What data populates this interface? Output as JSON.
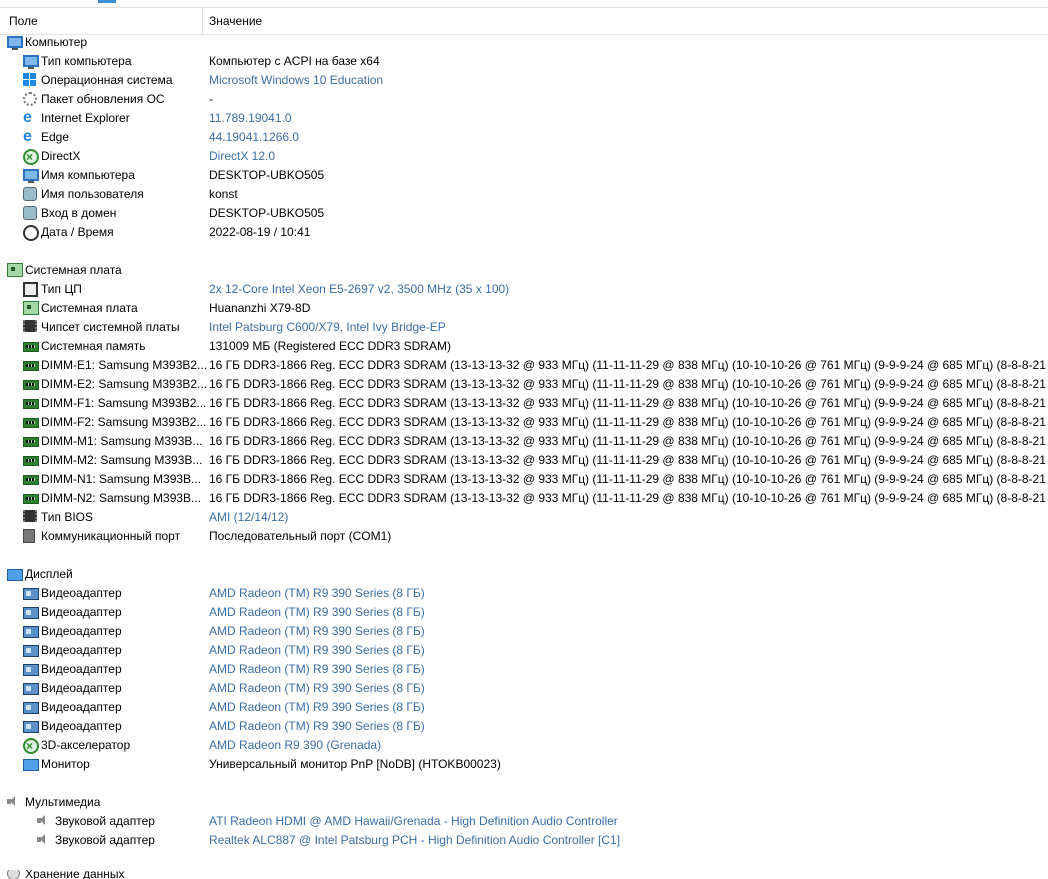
{
  "header": {
    "col_field": "Поле",
    "col_value": "Значение"
  },
  "computer": {
    "title": "Компьютер",
    "rows": [
      {
        "label": "Тип компьютера",
        "value": "Компьютер с ACPI на базе x64"
      },
      {
        "label": "Операционная система",
        "value": "Microsoft Windows 10 Education"
      },
      {
        "label": "Пакет обновления ОС",
        "value": "-"
      },
      {
        "label": "Internet Explorer",
        "value": "11.789.19041.0"
      },
      {
        "label": "Edge",
        "value": "44.19041.1266.0"
      },
      {
        "label": "DirectX",
        "value": "DirectX 12.0"
      },
      {
        "label": "Имя компьютера",
        "value": "DESKTOP-UBKO505"
      },
      {
        "label": "Имя пользователя",
        "value": "konst"
      },
      {
        "label": "Вход в домен",
        "value": "DESKTOP-UBKO505"
      },
      {
        "label": "Дата / Время",
        "value": "2022-08-19 / 10:41"
      }
    ]
  },
  "motherboard": {
    "title": "Системная плата",
    "rows": [
      {
        "label": "Тип ЦП",
        "value": "2x 12-Core Intel Xeon E5-2697 v2, 3500 MHz (35 x 100)"
      },
      {
        "label": "Системная плата",
        "value": "Huananzhi X79-8D"
      },
      {
        "label": "Чипсет системной платы",
        "value": "Intel Patsburg C600/X79, Intel Ivy Bridge-EP"
      },
      {
        "label": "Системная память",
        "value": "131009 МБ  (Registered ECC DDR3 SDRAM)"
      },
      {
        "label": "DIMM-E1: Samsung M393B2...",
        "value": "16 ГБ DDR3-1866 Reg. ECC DDR3 SDRAM  (13-13-13-32 @ 933 МГц)  (11-11-11-29 @ 838 МГц)  (10-10-10-26 @ 761 МГц)  (9-9-9-24 @ 685 МГц)  (8-8-8-21 ..."
      },
      {
        "label": "DIMM-E2: Samsung M393B2...",
        "value": "16 ГБ DDR3-1866 Reg. ECC DDR3 SDRAM  (13-13-13-32 @ 933 МГц)  (11-11-11-29 @ 838 МГц)  (10-10-10-26 @ 761 МГц)  (9-9-9-24 @ 685 МГц)  (8-8-8-21 ..."
      },
      {
        "label": "DIMM-F1: Samsung M393B2...",
        "value": "16 ГБ DDR3-1866 Reg. ECC DDR3 SDRAM  (13-13-13-32 @ 933 МГц)  (11-11-11-29 @ 838 МГц)  (10-10-10-26 @ 761 МГц)  (9-9-9-24 @ 685 МГц)  (8-8-8-21 ..."
      },
      {
        "label": "DIMM-F2: Samsung M393B2...",
        "value": "16 ГБ DDR3-1866 Reg. ECC DDR3 SDRAM  (13-13-13-32 @ 933 МГц)  (11-11-11-29 @ 838 МГц)  (10-10-10-26 @ 761 МГц)  (9-9-9-24 @ 685 МГц)  (8-8-8-21 ..."
      },
      {
        "label": "DIMM-M1: Samsung M393B...",
        "value": "16 ГБ DDR3-1866 Reg. ECC DDR3 SDRAM  (13-13-13-32 @ 933 МГц)  (11-11-11-29 @ 838 МГц)  (10-10-10-26 @ 761 МГц)  (9-9-9-24 @ 685 МГц)  (8-8-8-21 ..."
      },
      {
        "label": "DIMM-M2: Samsung M393B...",
        "value": "16 ГБ DDR3-1866 Reg. ECC DDR3 SDRAM  (13-13-13-32 @ 933 МГц)  (11-11-11-29 @ 838 МГц)  (10-10-10-26 @ 761 МГц)  (9-9-9-24 @ 685 МГц)  (8-8-8-21 ..."
      },
      {
        "label": "DIMM-N1: Samsung M393B...",
        "value": "16 ГБ DDR3-1866 Reg. ECC DDR3 SDRAM  (13-13-13-32 @ 933 МГц)  (11-11-11-29 @ 838 МГц)  (10-10-10-26 @ 761 МГц)  (9-9-9-24 @ 685 МГц)  (8-8-8-21 ..."
      },
      {
        "label": "DIMM-N2: Samsung M393B...",
        "value": "16 ГБ DDR3-1866 Reg. ECC DDR3 SDRAM  (13-13-13-32 @ 933 МГц)  (11-11-11-29 @ 838 МГц)  (10-10-10-26 @ 761 МГц)  (9-9-9-24 @ 685 МГц)  (8-8-8-21 ..."
      },
      {
        "label": "Тип BIOS",
        "value": "AMI (12/14/12)"
      },
      {
        "label": "Коммуникационный порт",
        "value": "Последовательный порт (COM1)"
      }
    ]
  },
  "display": {
    "title": "Дисплей",
    "rows": [
      {
        "label": "Видеоадаптер",
        "value": "AMD Radeon (TM) R9 390 Series  (8 ГБ)"
      },
      {
        "label": "Видеоадаптер",
        "value": "AMD Radeon (TM) R9 390 Series  (8 ГБ)"
      },
      {
        "label": "Видеоадаптер",
        "value": "AMD Radeon (TM) R9 390 Series  (8 ГБ)"
      },
      {
        "label": "Видеоадаптер",
        "value": "AMD Radeon (TM) R9 390 Series  (8 ГБ)"
      },
      {
        "label": "Видеоадаптер",
        "value": "AMD Radeon (TM) R9 390 Series  (8 ГБ)"
      },
      {
        "label": "Видеоадаптер",
        "value": "AMD Radeon (TM) R9 390 Series  (8 ГБ)"
      },
      {
        "label": "Видеоадаптер",
        "value": "AMD Radeon (TM) R9 390 Series  (8 ГБ)"
      },
      {
        "label": "Видеоадаптер",
        "value": "AMD Radeon (TM) R9 390 Series  (8 ГБ)"
      },
      {
        "label": "3D-акселератор",
        "value": "AMD Radeon R9 390 (Grenada)"
      },
      {
        "label": "Монитор",
        "value": "Универсальный монитор PnP [NoDB]  (HTOKB00023)"
      }
    ]
  },
  "multimedia": {
    "title": "Мультимедиа",
    "rows": [
      {
        "label": "Звуковой адаптер",
        "value": "ATI Radeon HDMI @ AMD Hawaii/Grenada - High Definition Audio Controller"
      },
      {
        "label": "Звуковой адаптер",
        "value": "Realtek ALC887 @ Intel Patsburg PCH - High Definition Audio Controller [C1]"
      }
    ]
  },
  "storage": {
    "title": "Хранение данных"
  },
  "colors": {
    "link": "#3a6ea5",
    "text": "#000000"
  }
}
